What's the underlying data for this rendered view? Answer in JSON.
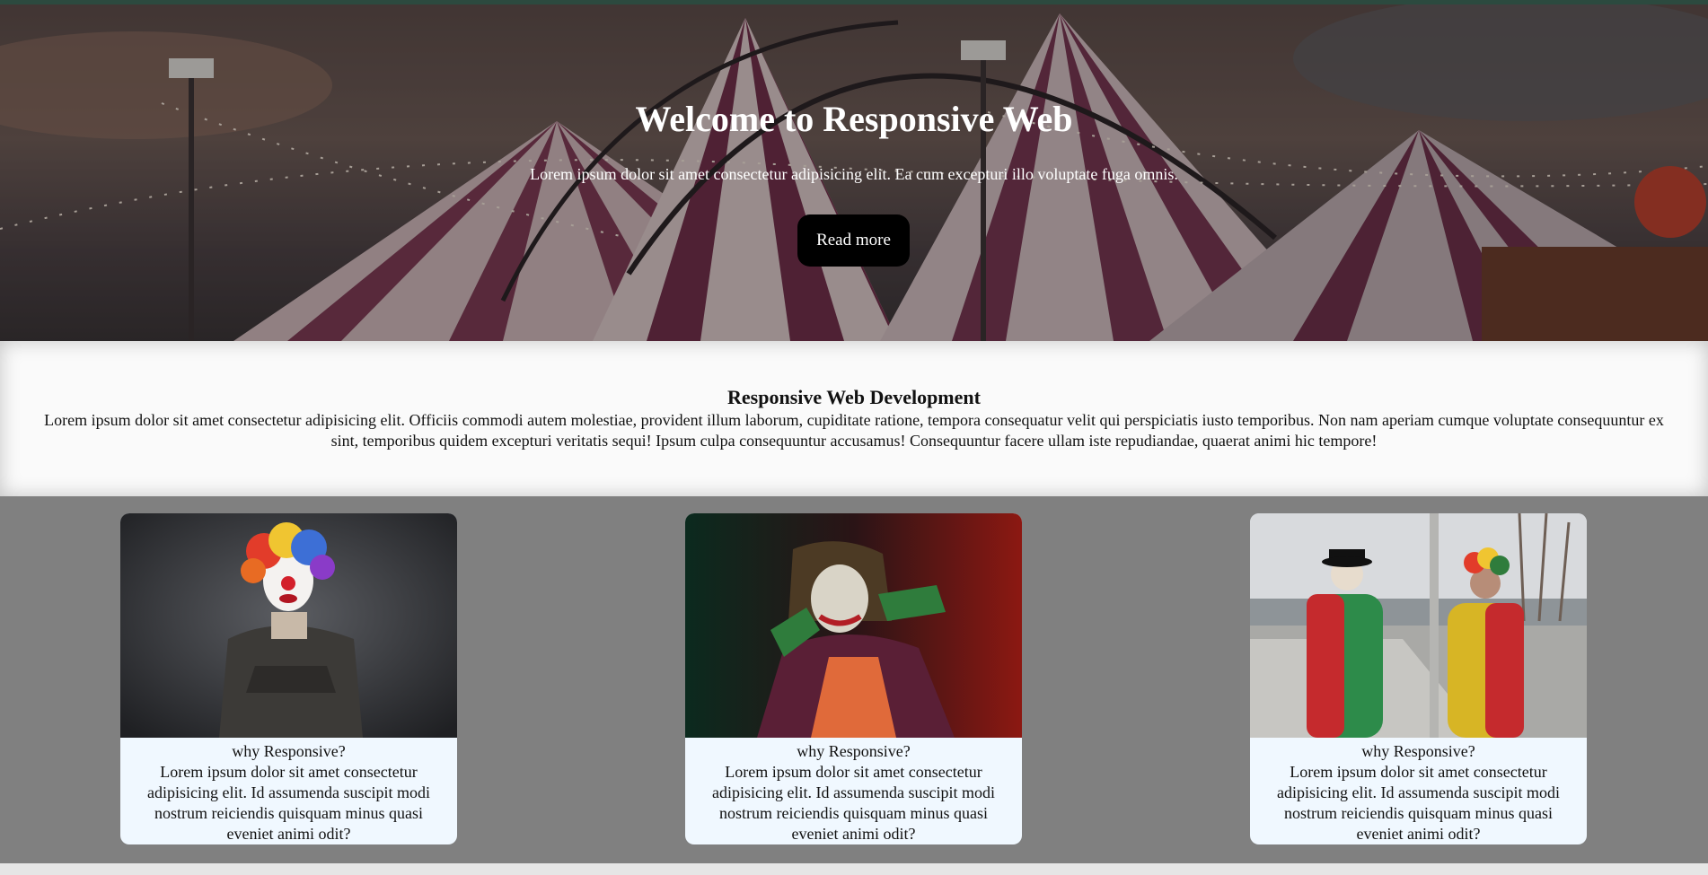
{
  "hero": {
    "title": "Welcome to Responsive Web",
    "text": "Lorem ipsum dolor sit amet consectetur adipisicing elit. Ea cum excepturi illo voluptate fuga omnis.",
    "button_label": "Read more"
  },
  "about": {
    "title": "Responsive Web Development",
    "text": "Lorem ipsum dolor sit amet consectetur adipisicing elit. Officiis commodi autem molestiae, provident illum laborum, cupiditate ratione, tempora consequatur velit qui perspiciatis iusto temporibus. Non nam aperiam cumque voluptate consequuntur ex sint, temporibus quidem excepturi veritatis sequi! Ipsum culpa consequuntur accusamus! Consequuntur facere ullam iste repudiandae, quaerat animi hic tempore!"
  },
  "cards": [
    {
      "title": "why Responsive?",
      "text": "Lorem ipsum dolor sit amet consectetur adipisicing elit. Id assumenda suscipit modi nostrum reiciendis quisquam minus quasi eveniet animi odit?"
    },
    {
      "title": "why Responsive?",
      "text": "Lorem ipsum dolor sit amet consectetur adipisicing elit. Id assumenda suscipit modi nostrum reiciendis quisquam minus quasi eveniet animi odit?"
    },
    {
      "title": "why Responsive?",
      "text": "Lorem ipsum dolor sit amet consectetur adipisicing elit. Id assumenda suscipit modi nostrum reiciendis quisquam minus quasi eveniet animi odit?"
    }
  ],
  "colors": {
    "hero_button_bg": "#000000",
    "cards_section_bg": "#808080",
    "card_bg": "#f0f8ff",
    "about_bg": "#fafafa"
  }
}
